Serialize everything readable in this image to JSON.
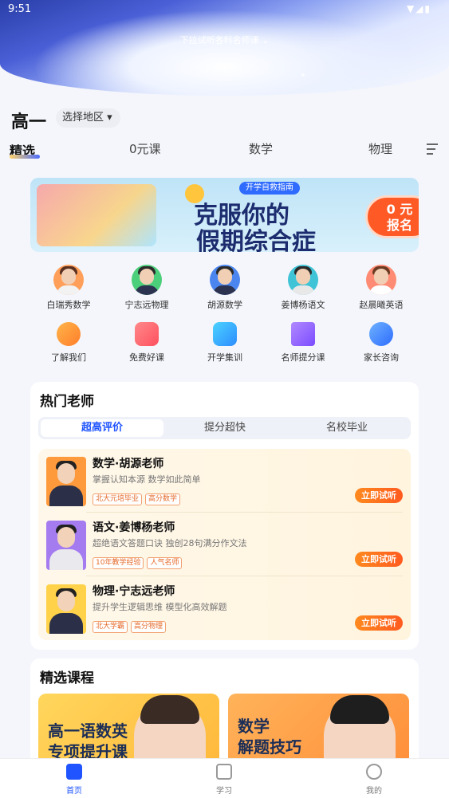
{
  "status": {
    "time": "9:51",
    "icons": "▼◢▮"
  },
  "pull_hint": "下拉试听各科名师课 ⌄",
  "grade": "高一",
  "region_label": "选择地区 ▾",
  "tabs": [
    {
      "label": "精选"
    },
    {
      "label": "0元课"
    },
    {
      "label": "数学"
    },
    {
      "label": "物理"
    }
  ],
  "banner": {
    "ribbon": "开学自救指南",
    "line1": "克服你的",
    "line2": "假期综合症",
    "cta_top": "0 元",
    "cta_bottom": "报名"
  },
  "teachers": [
    {
      "label": "白瑞秀数学"
    },
    {
      "label": "宁志远物理"
    },
    {
      "label": "胡源数学"
    },
    {
      "label": "姜博杨语文"
    },
    {
      "label": "赵晨曦英语"
    }
  ],
  "functions": [
    {
      "label": "了解我们",
      "icon": "heart-badge-icon"
    },
    {
      "label": "免费好课",
      "icon": "gift-icon"
    },
    {
      "label": "开学集训",
      "icon": "chart-icon"
    },
    {
      "label": "名师提分课",
      "icon": "graduation-cap-icon"
    },
    {
      "label": "家长咨询",
      "icon": "chat-person-icon"
    }
  ],
  "hot": {
    "title": "热门老师",
    "segments": [
      "超高评价",
      "提分超快",
      "名校毕业"
    ],
    "rows": [
      {
        "name": "数学·胡源老师",
        "desc": "掌握认知本源 数学如此简单",
        "tags": [
          "北大元培毕业",
          "高分数学"
        ],
        "button": "立即试听"
      },
      {
        "name": "语文·姜博杨老师",
        "desc": "超绝语文答题口诀 独创28句满分作文法",
        "tags": [
          "10年教学经验",
          "人气名师"
        ],
        "button": "立即试听"
      },
      {
        "name": "物理·宁志远老师",
        "desc": "提升学生逻辑思维 模型化高效解题",
        "tags": [
          "北大学霸",
          "高分物理"
        ],
        "button": "立即试听"
      }
    ]
  },
  "courses": {
    "title": "精选课程",
    "items": [
      {
        "text1": "高一语数英",
        "text2": "专项提升课"
      },
      {
        "text1": "数学",
        "text2": "解题技巧"
      }
    ]
  },
  "nav": [
    {
      "label": "首页"
    },
    {
      "label": "学习"
    },
    {
      "label": "我的"
    }
  ],
  "colors": {
    "accent": "#1f54ff",
    "cta": "#ff5a25"
  }
}
